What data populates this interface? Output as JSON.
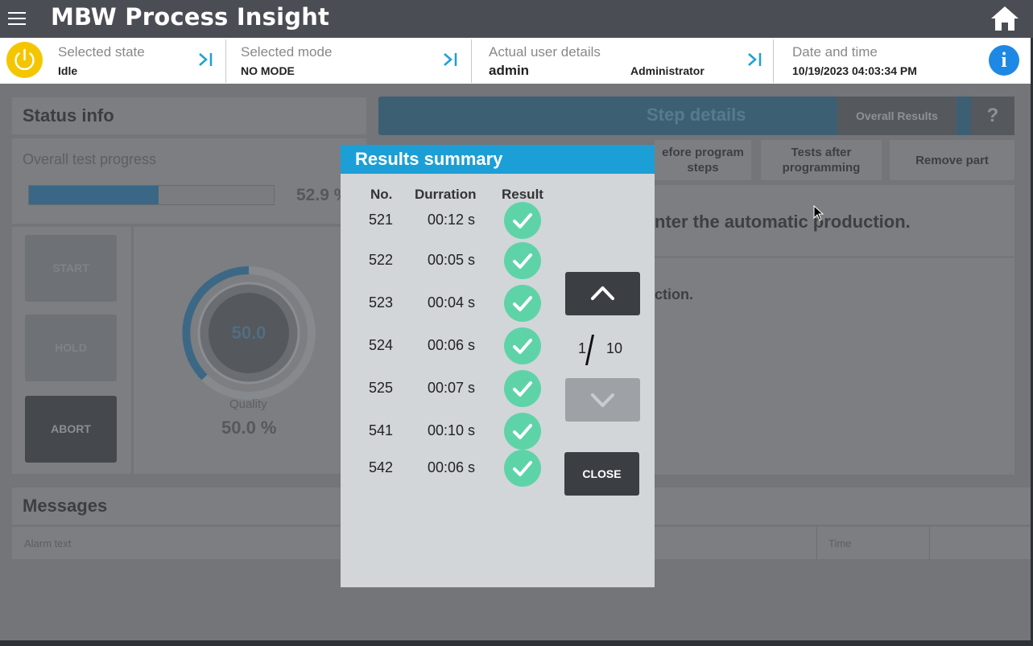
{
  "app": {
    "title": "MBW Process Insight"
  },
  "status": {
    "state_label": "Selected state",
    "state_value": "Idle",
    "mode_label": "Selected mode",
    "mode_value": "NO MODE",
    "user_label": "Actual user details",
    "user_name": "admin",
    "user_role": "Administrator",
    "datetime_label": "Date and time",
    "datetime_value": "10/19/2023 04:03:34 PM"
  },
  "status_info": {
    "title": "Status info",
    "progress_label": "Overall test progress",
    "progress_value": "52.9 %",
    "progress_fraction": 0.529,
    "buttons": {
      "start": "START",
      "hold": "HOLD",
      "abort": "ABORT"
    },
    "gauge_value": "50.0",
    "quality_label": "Quality",
    "quality_value": "50.0 %"
  },
  "step_details": {
    "title": "Step details",
    "overall_results": "Overall Results",
    "help": "?",
    "tabs": [
      "efore program steps",
      "Tests after programming",
      "Remove part"
    ],
    "line1": "nter the automatic production.",
    "line2": "ction."
  },
  "messages": {
    "title": "Messages",
    "col_alarm": "Alarm text",
    "col_time": "Time"
  },
  "modal": {
    "title": "Results summary",
    "headers": {
      "no": "No.",
      "duration": "Durration",
      "result": "Result"
    },
    "rows": [
      {
        "no": "521",
        "duration": "00:12 s",
        "result": "pass"
      },
      {
        "no": "522",
        "duration": "00:05 s",
        "result": "pass"
      },
      {
        "no": "523",
        "duration": "00:04 s",
        "result": "pass"
      },
      {
        "no": "524",
        "duration": "00:06 s",
        "result": "pass"
      },
      {
        "no": "525",
        "duration": "00:07 s",
        "result": "pass"
      },
      {
        "no": "541",
        "duration": "00:10 s",
        "result": "pass"
      },
      {
        "no": "542",
        "duration": "00:06 s",
        "result": "pass"
      }
    ],
    "page_current": "1",
    "page_total": "10",
    "close_label": "CLOSE"
  },
  "colors": {
    "accent": "#1c9fd6",
    "power": "#f4c600",
    "check": "#5fd3a8",
    "info": "#1e88e5"
  }
}
